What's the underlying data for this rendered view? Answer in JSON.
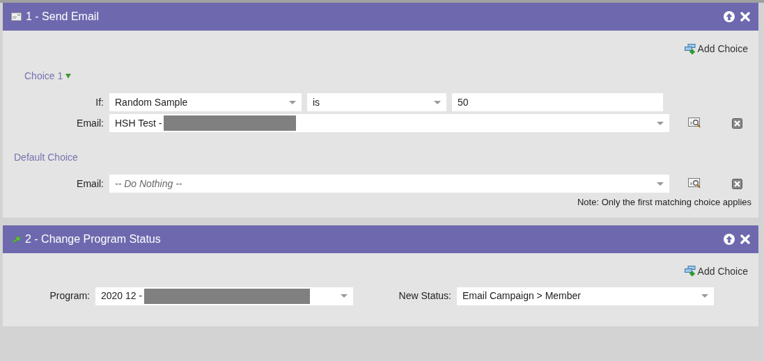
{
  "panels": [
    {
      "kind": "choices",
      "title": "1 - Send Email",
      "add_choice": "Add Choice",
      "choices": [
        {
          "title": "Choice 1",
          "condition": {
            "label": "If:",
            "attribute": "Random Sample",
            "operator": "is",
            "value": "50"
          },
          "email": {
            "label": "Email:",
            "value": "HSH Test -",
            "redacted": true,
            "empty": false
          }
        }
      ],
      "default_choice": {
        "title": "Default Choice",
        "email": {
          "label": "Email:",
          "value": "-- Do Nothing --",
          "redacted": false,
          "empty": true
        }
      },
      "note": "Note: Only the first matching choice applies"
    },
    {
      "kind": "fields",
      "title": "2 - Change Program Status",
      "add_choice": "Add Choice",
      "fields": [
        {
          "label": "Program:",
          "value": "2020 12 -",
          "redacted": true
        },
        {
          "label": "New Status:",
          "value": "Email Campaign > Member"
        }
      ]
    }
  ]
}
